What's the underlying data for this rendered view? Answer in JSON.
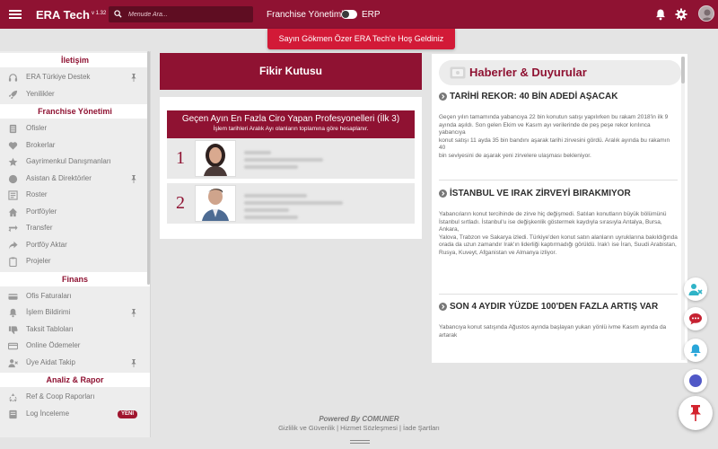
{
  "topbar": {
    "brand": "ERA Tech",
    "version": "v 1.32",
    "search_placeholder": "Menude Ara...",
    "franchise_label": "Franchise Yönetimi",
    "erp_label": "ERP",
    "bg_color": "#8f1232"
  },
  "toast": {
    "message": "Sayın Gökmen Özer ERA Tech'e Hoş Geldiniz"
  },
  "sidebar": {
    "sections": [
      {
        "title": "İletişim",
        "items": [
          {
            "label": "ERA Türkiye Destek",
            "icon": "headset-icon",
            "pinned": true
          },
          {
            "label": "Yenilikler",
            "icon": "rocket-icon"
          }
        ]
      },
      {
        "title": "Franchise Yönetimi",
        "items": [
          {
            "label": "Ofisler",
            "icon": "office-icon"
          },
          {
            "label": "Brokerlar",
            "icon": "heart-icon"
          },
          {
            "label": "Gayrimenkul Danışmanları",
            "icon": "star-icon"
          },
          {
            "label": "Asistan & Direktörler",
            "icon": "circle-user-icon",
            "pinned": true
          },
          {
            "label": "Roster",
            "icon": "roster-icon"
          },
          {
            "label": "Portföyler",
            "icon": "home-icon"
          },
          {
            "label": "Transfer",
            "icon": "transfer-icon"
          },
          {
            "label": "Portföy Aktar",
            "icon": "share-icon"
          },
          {
            "label": "Projeler",
            "icon": "clipboard-icon"
          }
        ]
      },
      {
        "title": "Finans",
        "items": [
          {
            "label": "Ofis Faturaları",
            "icon": "credit-card-icon"
          },
          {
            "label": "İşlem Bildirimi",
            "icon": "bell-icon",
            "pinned": true
          },
          {
            "label": "Taksit Tabloları",
            "icon": "thumbs-down-icon"
          },
          {
            "label": "Online Ödemeler",
            "icon": "card-icon"
          },
          {
            "label": "Üye Aidat Takip",
            "icon": "user-x-icon",
            "pinned": true
          }
        ]
      },
      {
        "title": "Analiz & Rapor",
        "items": [
          {
            "label": "Ref & Coop Raporları",
            "icon": "recycle-icon"
          },
          {
            "label": "Log İnceleme",
            "icon": "log-icon",
            "badge": "YENİ"
          }
        ]
      }
    ]
  },
  "fikir": {
    "title": "Fikir Kutusu"
  },
  "top_panel": {
    "title": "Geçen Ayın En Fazla Ciro Yapan Profesyonelleri (İlk 3)",
    "subtitle": "İşlem tarihleri Aralık Ayı olanların toplamına göre hesaplanır.",
    "ranks": [
      "1",
      "2"
    ]
  },
  "news": {
    "title": "Haberler & Duyurular",
    "articles": [
      {
        "title": "TARİHİ REKOR: 40 BİN ADEDİ AŞACAK",
        "body": "Geçen yılın tamamında yabancıya 22 bin konutun satışı yapılırken bu rakam 2018'in ilk 9\nayında aşıldı. Son gelen Ekim ve Kasım ayı verilerinde de peş peşe rekor kırılınca yabancıya\nkonut satışı 11 ayda 35 bin bandını aşarak tarihi zirvesini gördü. Aralık ayında bu rakamın 40\nbin seviyesini de aşarak yeni zirvelere ulaşması bekleniyor."
      },
      {
        "title": "İSTANBUL VE IRAK ZİRVEYİ BIRAKMIYOR",
        "body": "Yabancıların konut tercihinde de zirve hiç değişmedi. Satılan konutların büyük bölümünü\nİstanbul sırtladı. İstanbul'u ise değişkenlik göstermek kaydıyla sırasıyla Antalya, Bursa, Ankara,\nYalova, Trabzon ve Sakarya izledi. Türkiye'den konut satın alanların uyruklarına bakıldığında\norada da uzun zamandır Irak'ın liderliği kaptırmadığı görüldü. Irak'ı ise İran, Suudi Arabistan,\nRusya, Kuveyt, Afganistan ve Almanya izliyor."
      },
      {
        "title": "SON 4 AYDIR YÜZDE 100'DEN FAZLA ARTIŞ VAR",
        "body": "Yabancıya konut satışında Ağustos ayında başlayan yukarı yönlü ivme Kasım ayında da artarak"
      }
    ]
  },
  "footer": {
    "powered": "Powered By COMUNER",
    "links": "Gizlilik ve Güvenlik | Hizmet Sözleşmesi | İade Şartları"
  }
}
